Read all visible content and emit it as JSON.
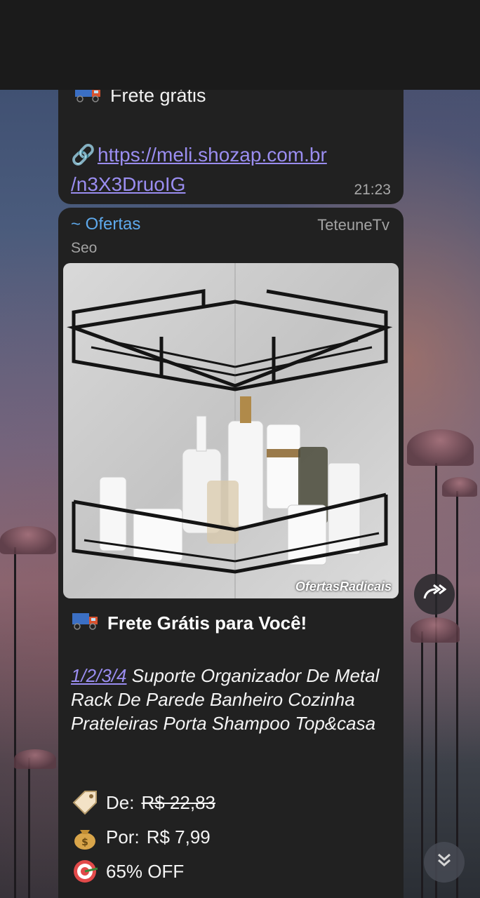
{
  "message1": {
    "shipping": "Frete grátis",
    "link": "https://meli.shozap.com.br/n3X3DruoIG",
    "link_line1": "https://meli.shozap.com.br",
    "link_line2": "/n3X3DruoIG",
    "time": "21:23"
  },
  "message2": {
    "forwarded_from": "~ Ofertas",
    "channel": "TeteuneTv",
    "sub": "Seo",
    "photo_watermark": "OfertasRadicais",
    "headline": "Frete Grátis para Você!",
    "desc_link": "1/2/3/4",
    "description": " Suporte Organizador De Metal Rack De Parede Banheiro Cozinha Prateleiras Porta Shampoo Top&casa",
    "price_from_label": "De:",
    "price_from": "R$ 22,83",
    "price_to_label": "Por:",
    "price_to": "R$ 7,99",
    "discount": "65% OFF"
  },
  "icons": {
    "truck": "truck-icon",
    "link": "link-icon",
    "tag": "tag-icon",
    "money_bag": "money-bag-icon",
    "target": "target-icon",
    "share": "share-icon",
    "scroll_down": "chevrons-down-icon"
  },
  "colors": {
    "bubble": "#212121",
    "link": "#9a8df0",
    "channel_name": "#5ea9ec"
  }
}
